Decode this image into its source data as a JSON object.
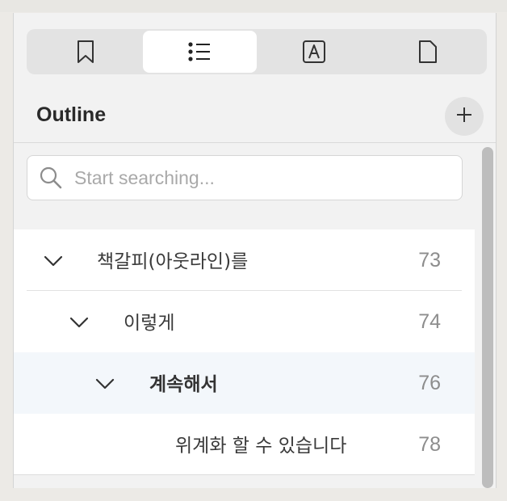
{
  "tabs": [
    {
      "name": "bookmark-icon"
    },
    {
      "name": "list-icon",
      "active": true
    },
    {
      "name": "text-box-icon"
    },
    {
      "name": "page-icon"
    }
  ],
  "outline": {
    "title": "Outline",
    "add_icon": "plus-icon"
  },
  "search": {
    "placeholder": "Start searching..."
  },
  "items": [
    {
      "label": "책갈피(아웃라인)를",
      "page": "73",
      "level": 0,
      "expanded": true
    },
    {
      "label": "이렇게",
      "page": "74",
      "level": 1,
      "expanded": true
    },
    {
      "label": "계속해서",
      "page": "76",
      "level": 2,
      "expanded": true,
      "selected": true
    },
    {
      "label": "위계화 할 수 있습니다",
      "page": "78",
      "level": 3
    }
  ],
  "colors": {
    "panel_bg": "#f2f2f2",
    "selected_row": "#f3f7fb",
    "page_number": "#8d8d8d"
  }
}
